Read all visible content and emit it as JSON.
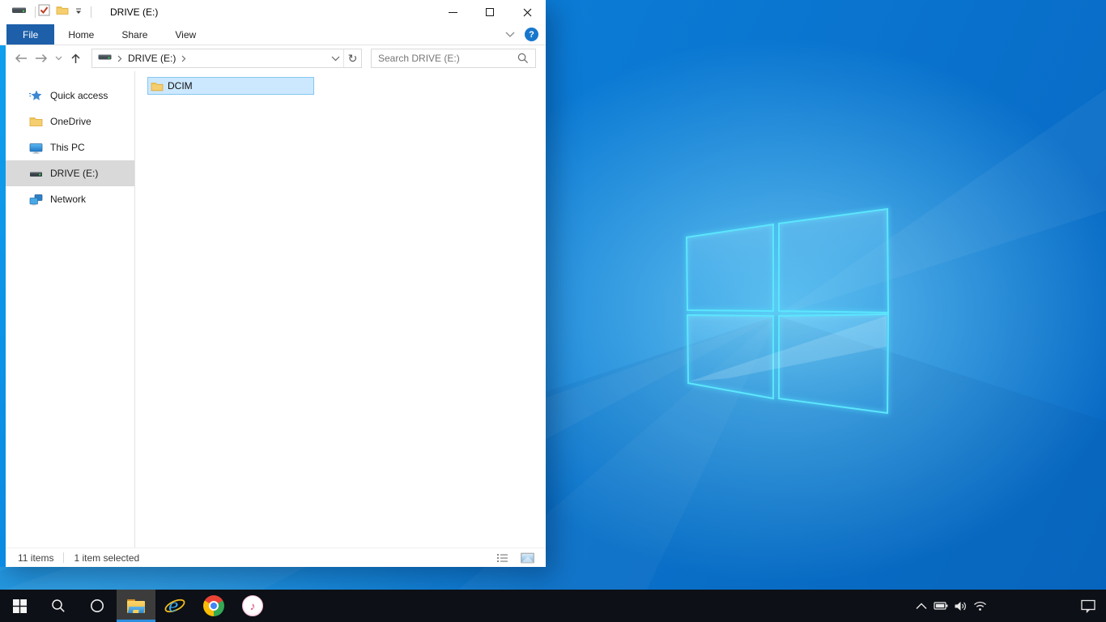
{
  "window": {
    "title": "DRIVE (E:)",
    "tabs": {
      "file": "File",
      "home": "Home",
      "share": "Share",
      "view": "View"
    },
    "nav": {
      "breadcrumb_root": "DRIVE (E:)",
      "search_placeholder": "Search DRIVE (E:)"
    },
    "sidebar": {
      "items": [
        {
          "label": "Quick access"
        },
        {
          "label": "OneDrive"
        },
        {
          "label": "This PC"
        },
        {
          "label": "DRIVE (E:)",
          "selected": true
        },
        {
          "label": "Network"
        }
      ]
    },
    "files": [
      {
        "name": "DCIM",
        "selected": true
      }
    ],
    "status": {
      "items": "11 items",
      "selected": "1 item selected"
    }
  },
  "glyphs": {
    "refresh": "↻",
    "help": "?",
    "itunes_note": "♪"
  },
  "colors": {
    "accent_tab": "#1d5fa9",
    "selection_bg": "#cce8ff",
    "selection_border": "#84c7f0",
    "sidebar_selected": "#d9d9d9",
    "taskbar_underline": "#2b8fe0"
  }
}
